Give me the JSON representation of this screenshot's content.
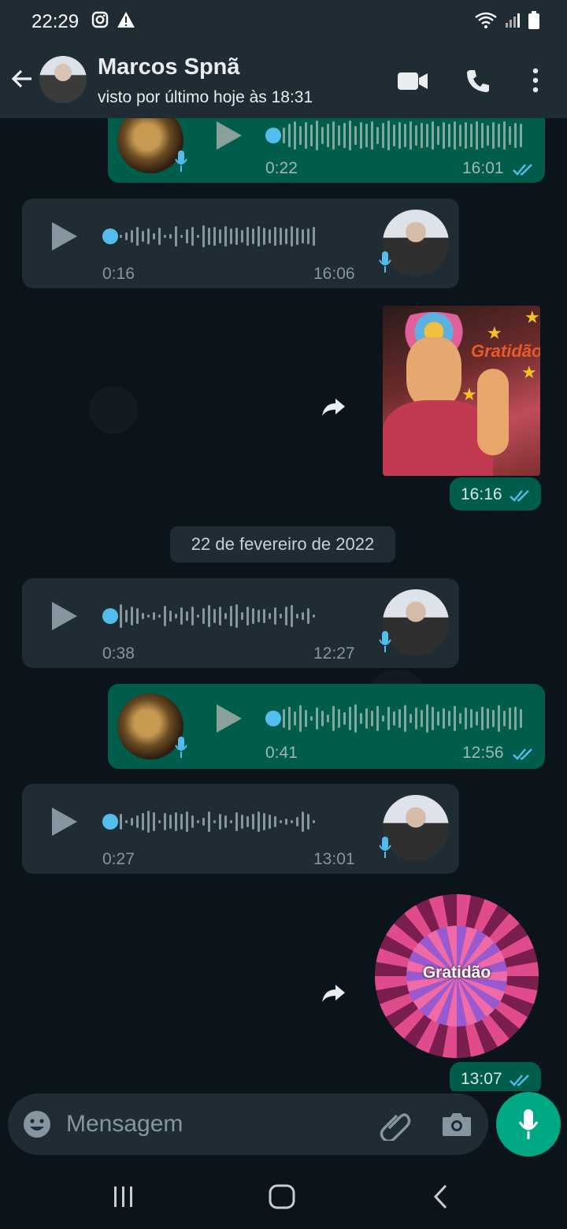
{
  "status_bar": {
    "time": "22:29"
  },
  "header": {
    "name": "Marcos Spnã",
    "subtitle": "visto por último hoje às 18:31"
  },
  "messages": [
    {
      "type": "voice",
      "direction": "out",
      "duration": "0:22",
      "time": "16:01",
      "status": "read"
    },
    {
      "type": "voice",
      "direction": "in",
      "duration": "0:16",
      "time": "16:06"
    },
    {
      "type": "sticker",
      "direction": "out",
      "text": "Gratidão",
      "time": "16:16",
      "status": "read"
    },
    {
      "type": "date",
      "text": "22 de fevereiro de 2022"
    },
    {
      "type": "voice",
      "direction": "in",
      "duration": "0:38",
      "time": "12:27"
    },
    {
      "type": "voice",
      "direction": "out",
      "duration": "0:41",
      "time": "12:56",
      "status": "read"
    },
    {
      "type": "voice",
      "direction": "in",
      "duration": "0:27",
      "time": "13:01"
    },
    {
      "type": "sticker",
      "direction": "out",
      "text": "Gratidão",
      "time": "13:07",
      "status": "read"
    }
  ],
  "input": {
    "placeholder": "Mensagem"
  },
  "colors": {
    "accent": "#00a884",
    "outgoing": "#005c4b",
    "incoming": "#1f2c34",
    "read_ticks": "#53bdeb"
  }
}
